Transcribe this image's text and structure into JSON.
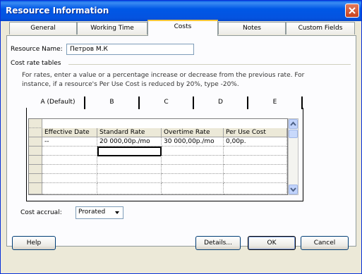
{
  "window": {
    "title": "Resource Information"
  },
  "tabs": [
    {
      "label": "General"
    },
    {
      "label": "Working Time"
    },
    {
      "label": "Costs"
    },
    {
      "label": "Notes"
    },
    {
      "label": "Custom Fields"
    }
  ],
  "resource": {
    "name_label": "Resource Name:",
    "name_value": "Петров М.К"
  },
  "cost_tables": {
    "group_label": "Cost rate tables",
    "help_text_line1": "For rates, enter a value or a percentage increase or decrease from the previous rate. For",
    "help_text_line2": "instance, if a resource's Per Use Cost is reduced by 20%, type -20%.",
    "tabs": [
      {
        "label": "A (Default)"
      },
      {
        "label": "B"
      },
      {
        "label": "C"
      },
      {
        "label": "D"
      },
      {
        "label": "E"
      }
    ],
    "columns": [
      "Effective Date",
      "Standard Rate",
      "Overtime Rate",
      "Per Use Cost"
    ],
    "rows": [
      [
        "--",
        "20 000,00р./mo",
        "30 000,00р./mo",
        "0,00р."
      ]
    ]
  },
  "cost_accrual": {
    "label": "Cost accrual:",
    "value": "Prorated"
  },
  "buttons": {
    "help": "Help",
    "details": "Details...",
    "ok": "OK",
    "cancel": "Cancel"
  },
  "colors": {
    "title_bar": "#0058e6",
    "dialog_bg": "#ece9d8",
    "tab_highlight": "#ffc83c"
  }
}
